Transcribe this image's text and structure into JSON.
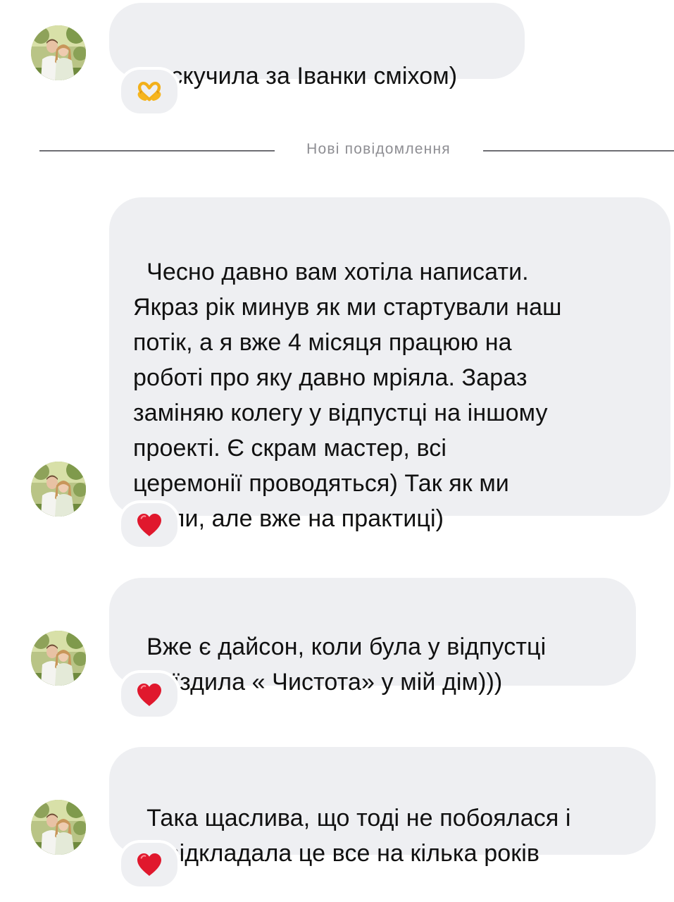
{
  "divider": {
    "label": "Нові повідомлення"
  },
  "messages": [
    {
      "text": "Я скучила за Іванки сміхом)",
      "reaction": "heart-hands-emoji"
    },
    {
      "text": "Чесно давно вам хотіла написати.\nЯкраз рік минув як ми стартували наш\nпотік, а я вже 4 місяця працюю на\nроботі про яку давно мріяла. Зараз\nзаміняю колегу у відпустці на іншому\nпроекті. Є скрам мастер, всі\nцеремонії проводяться) Так як ми\nвчили, але вже на практиці)",
      "reaction": "red-heart-emoji"
    },
    {
      "text": "Вже є дайсон, коли була у відпустці\nприїздила « Чистота» у мій дім)))",
      "reaction": "red-heart-emoji"
    },
    {
      "text": "Така щаслива, що тоді не побоялася і\nне відкладала це все на кілька років",
      "reaction": "red-heart-emoji"
    }
  ],
  "colors": {
    "bubble_bg": "#eeeff2",
    "text": "#111111",
    "divider_text": "#8e8e93",
    "heart": "#e0182d",
    "heart_hands": "#f6b51e"
  }
}
